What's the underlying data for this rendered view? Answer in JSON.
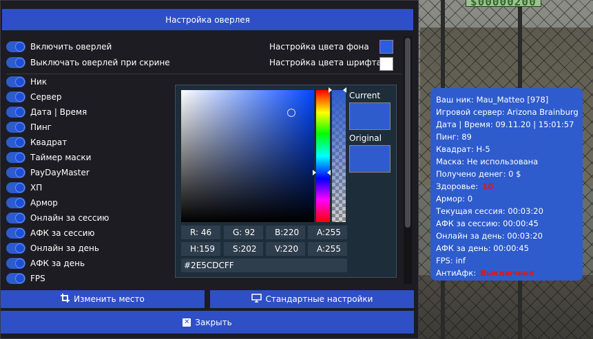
{
  "window": {
    "title": "Настройка оверлея"
  },
  "settings": {
    "toggles_top": [
      {
        "label": "Включить оверлей",
        "on": true
      },
      {
        "label": "Выключать оверлей при скрине",
        "on": true
      }
    ],
    "bg_color_label": "Настройка цвета фона",
    "bg_color": "#2E5CDC",
    "font_color_label": "Настройка цвета шрифта",
    "font_color": "#FFFFFF",
    "items": [
      {
        "label": "Ник",
        "on": true
      },
      {
        "label": "Сервер",
        "on": true
      },
      {
        "label": "Дата | Время",
        "on": true
      },
      {
        "label": "Пинг",
        "on": true
      },
      {
        "label": "Квадрат",
        "on": true
      },
      {
        "label": "Таймер маски",
        "on": true
      },
      {
        "label": "PayDayMaster",
        "on": true
      },
      {
        "label": "ХП",
        "on": true
      },
      {
        "label": "Армор",
        "on": true
      },
      {
        "label": "Онлайн за сессию",
        "on": true
      },
      {
        "label": "АФК за сессию",
        "on": true
      },
      {
        "label": "Онлайн за день",
        "on": true
      },
      {
        "label": "АФК за день",
        "on": true
      },
      {
        "label": "FPS",
        "on": true
      }
    ]
  },
  "picker": {
    "current_label": "Current",
    "original_label": "Original",
    "r": "R: 46",
    "g": "G: 92",
    "b": "B:220",
    "a1": "A:255",
    "h": "H:159",
    "s": "S:202",
    "v": "V:220",
    "a2": "A:255",
    "hex": "#2E5CDCFF",
    "color": "#2E5CDC"
  },
  "buttons": {
    "move": "Изменить место",
    "defaults": "Стандартные настройки",
    "close": "Закрыть"
  },
  "game": {
    "money": "$00000200"
  },
  "overlay": {
    "nick": "Ваш ник: Mau_Matteo [978]",
    "server": "Игровой сервер: Arizona Brainburg",
    "datetime": "Дата | Время: 09.11.20 | 15:01:57",
    "ping": "Пинг: 89",
    "square": "Квадрат: Н-5",
    "mask": "Маска: Не использована",
    "money": "Получено денег: 0 $",
    "health_label": "Здоровье:",
    "health_value": "10",
    "armor": "Армор: 0",
    "session": "Текущая сессия: 00:03:20",
    "afk_session": "АФК за сессию: 00:00:45",
    "online_day": "Онлайн за день: 00:03:20",
    "afk_day": "АФК за день: 00:00:45",
    "fps": "FPS:  inf",
    "antiafk_label": "АнтиАфк:",
    "antiafk_value": "Выключено"
  }
}
